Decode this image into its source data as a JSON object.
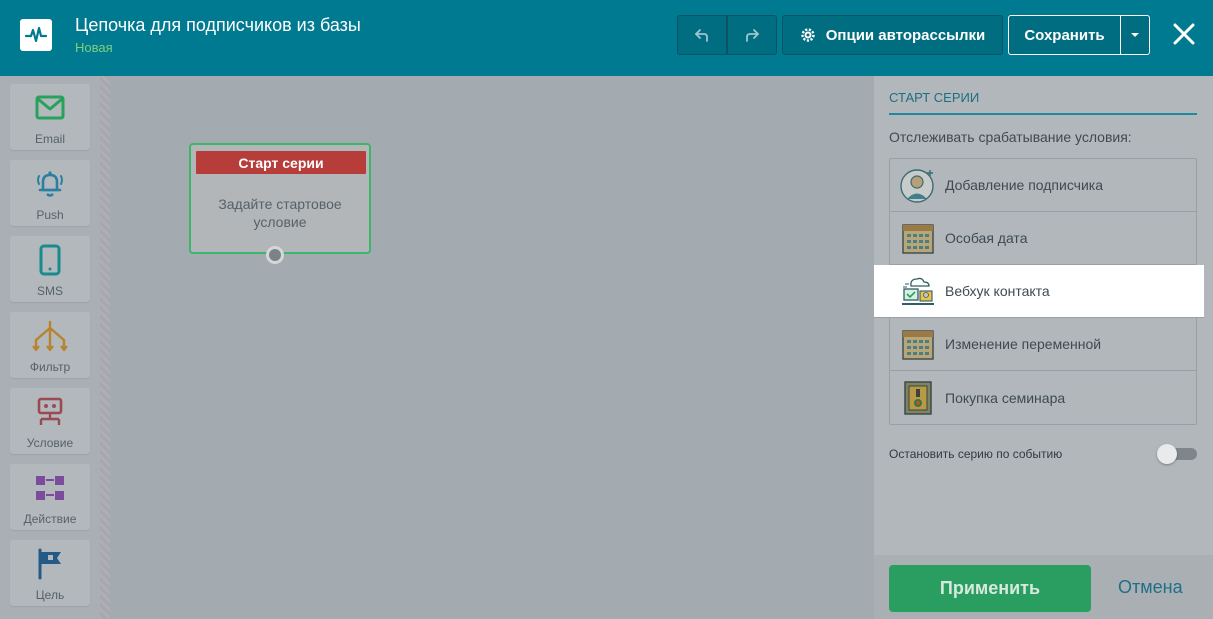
{
  "header": {
    "title": "Цепочка для подписчиков из базы",
    "status": "Новая",
    "options_label": "Опции авторассылки",
    "save_label": "Сохранить"
  },
  "toolbar": {
    "items": [
      {
        "label": "Email",
        "icon": "envelope-icon"
      },
      {
        "label": "Push",
        "icon": "bell-icon"
      },
      {
        "label": "SMS",
        "icon": "phone-icon"
      },
      {
        "label": "Фильтр",
        "icon": "filter-icon"
      },
      {
        "label": "Условие",
        "icon": "condition-icon"
      },
      {
        "label": "Действие",
        "icon": "action-icon"
      },
      {
        "label": "Цель",
        "icon": "flag-icon"
      }
    ]
  },
  "node": {
    "title": "Старт серии",
    "body": "Задайте стартовое условие"
  },
  "panel": {
    "title": "СТАРТ СЕРИИ",
    "description": "Отслеживать срабатывание условия:",
    "options": [
      {
        "label": "Добавление подписчика",
        "icon": "add-subscriber-icon"
      },
      {
        "label": "Особая дата",
        "icon": "calendar-icon"
      },
      {
        "label": "Вебхук контакта",
        "icon": "webhook-icon"
      },
      {
        "label": "Изменение переменной",
        "icon": "calendar-icon"
      },
      {
        "label": "Покупка семинара",
        "icon": "seminar-icon"
      }
    ],
    "stop_label": "Остановить серию по событию",
    "apply_label": "Применить",
    "cancel_label": "Отмена"
  },
  "colors": {
    "header_bg": "#007a90",
    "accent_green": "#2a9e61",
    "node_head": "#b73d3b",
    "status_green": "#7dd17b"
  }
}
